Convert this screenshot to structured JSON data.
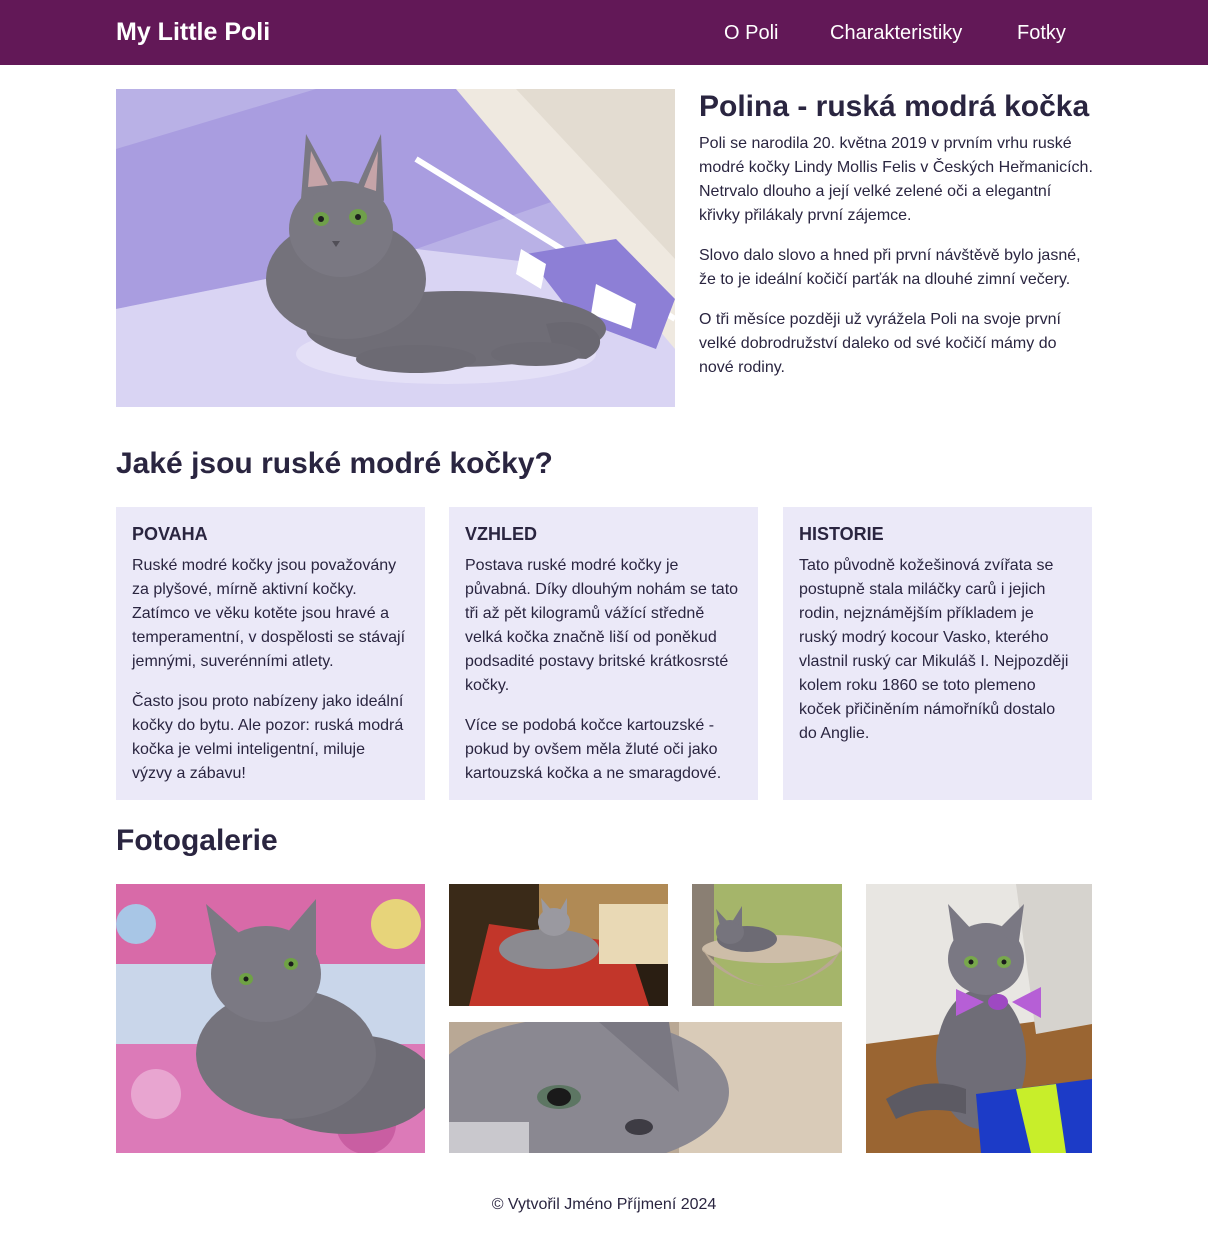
{
  "nav": {
    "brand": "My Little Poli",
    "links": [
      "O Poli",
      "Charakteristiky",
      "Fotky"
    ]
  },
  "intro": {
    "title": "Polina - ruská modrá kočka",
    "paragraphs": [
      "Poli se narodila 20. května 2019 v prvním vrhu ruské modré kočky Lindy Mollis Felis v Českých Heřmanicích. Netrvalo dlouho a její velké zelené oči a elegantní křivky přilákaly první zájemce.",
      "Slovo dalo slovo a hned při první návštěvě bylo jasné, že to je ideální kočičí parťák na dlouhé zimní večery.",
      "O tři měsíce později už vyrážela Poli na svoje první velké dobrodružství daleko od své kočičí mámy do nové rodiny."
    ]
  },
  "characteristics": {
    "title": "Jaké jsou ruské modré kočky?",
    "cards": [
      {
        "heading": "POVAHA",
        "paragraphs": [
          "Ruské modré kočky jsou považovány za plyšové, mírně aktivní kočky. Zatímco ve věku kotěte jsou hravé a temperamentní, v dospělosti se stávají jemnými, suverénními atlety.",
          "Často jsou proto nabízeny jako ideální kočky do bytu. Ale pozor: ruská modrá kočka je velmi inteligentní, miluje výzvy a zábavu!"
        ]
      },
      {
        "heading": "VZHLED",
        "paragraphs": [
          "Postava ruské modré kočky je půvabná. Díky dlouhým nohám se tato tři až pět kilogramů vážící středně velká kočka značně liší od poněkud podsadité postavy britské krátkosrsté kočky.",
          "Více se podobá kočce kartouzské - pokud by ovšem měla žluté oči jako kartouzská kočka a ne smaragdové."
        ]
      },
      {
        "heading": "HISTORIE",
        "paragraphs": [
          "Tato původně kožešinová zvířata se postupně stala miláčky carů i jejich rodin, nejznámějším příkladem je ruský modrý kocour Vasko, kterého vlastnil ruský car Mikuláš I. Nejpozději kolem roku 1860 se toto plemeno koček přičiněním námořníků dostalo do Anglie."
        ]
      }
    ]
  },
  "gallery": {
    "title": "Fotogalerie"
  },
  "footer": {
    "text": "© Vytvořil Jméno Příjmení 2024"
  },
  "colors": {
    "navbar": "#621857",
    "card_background": "#ebe9f8",
    "text": "#2a2540"
  }
}
